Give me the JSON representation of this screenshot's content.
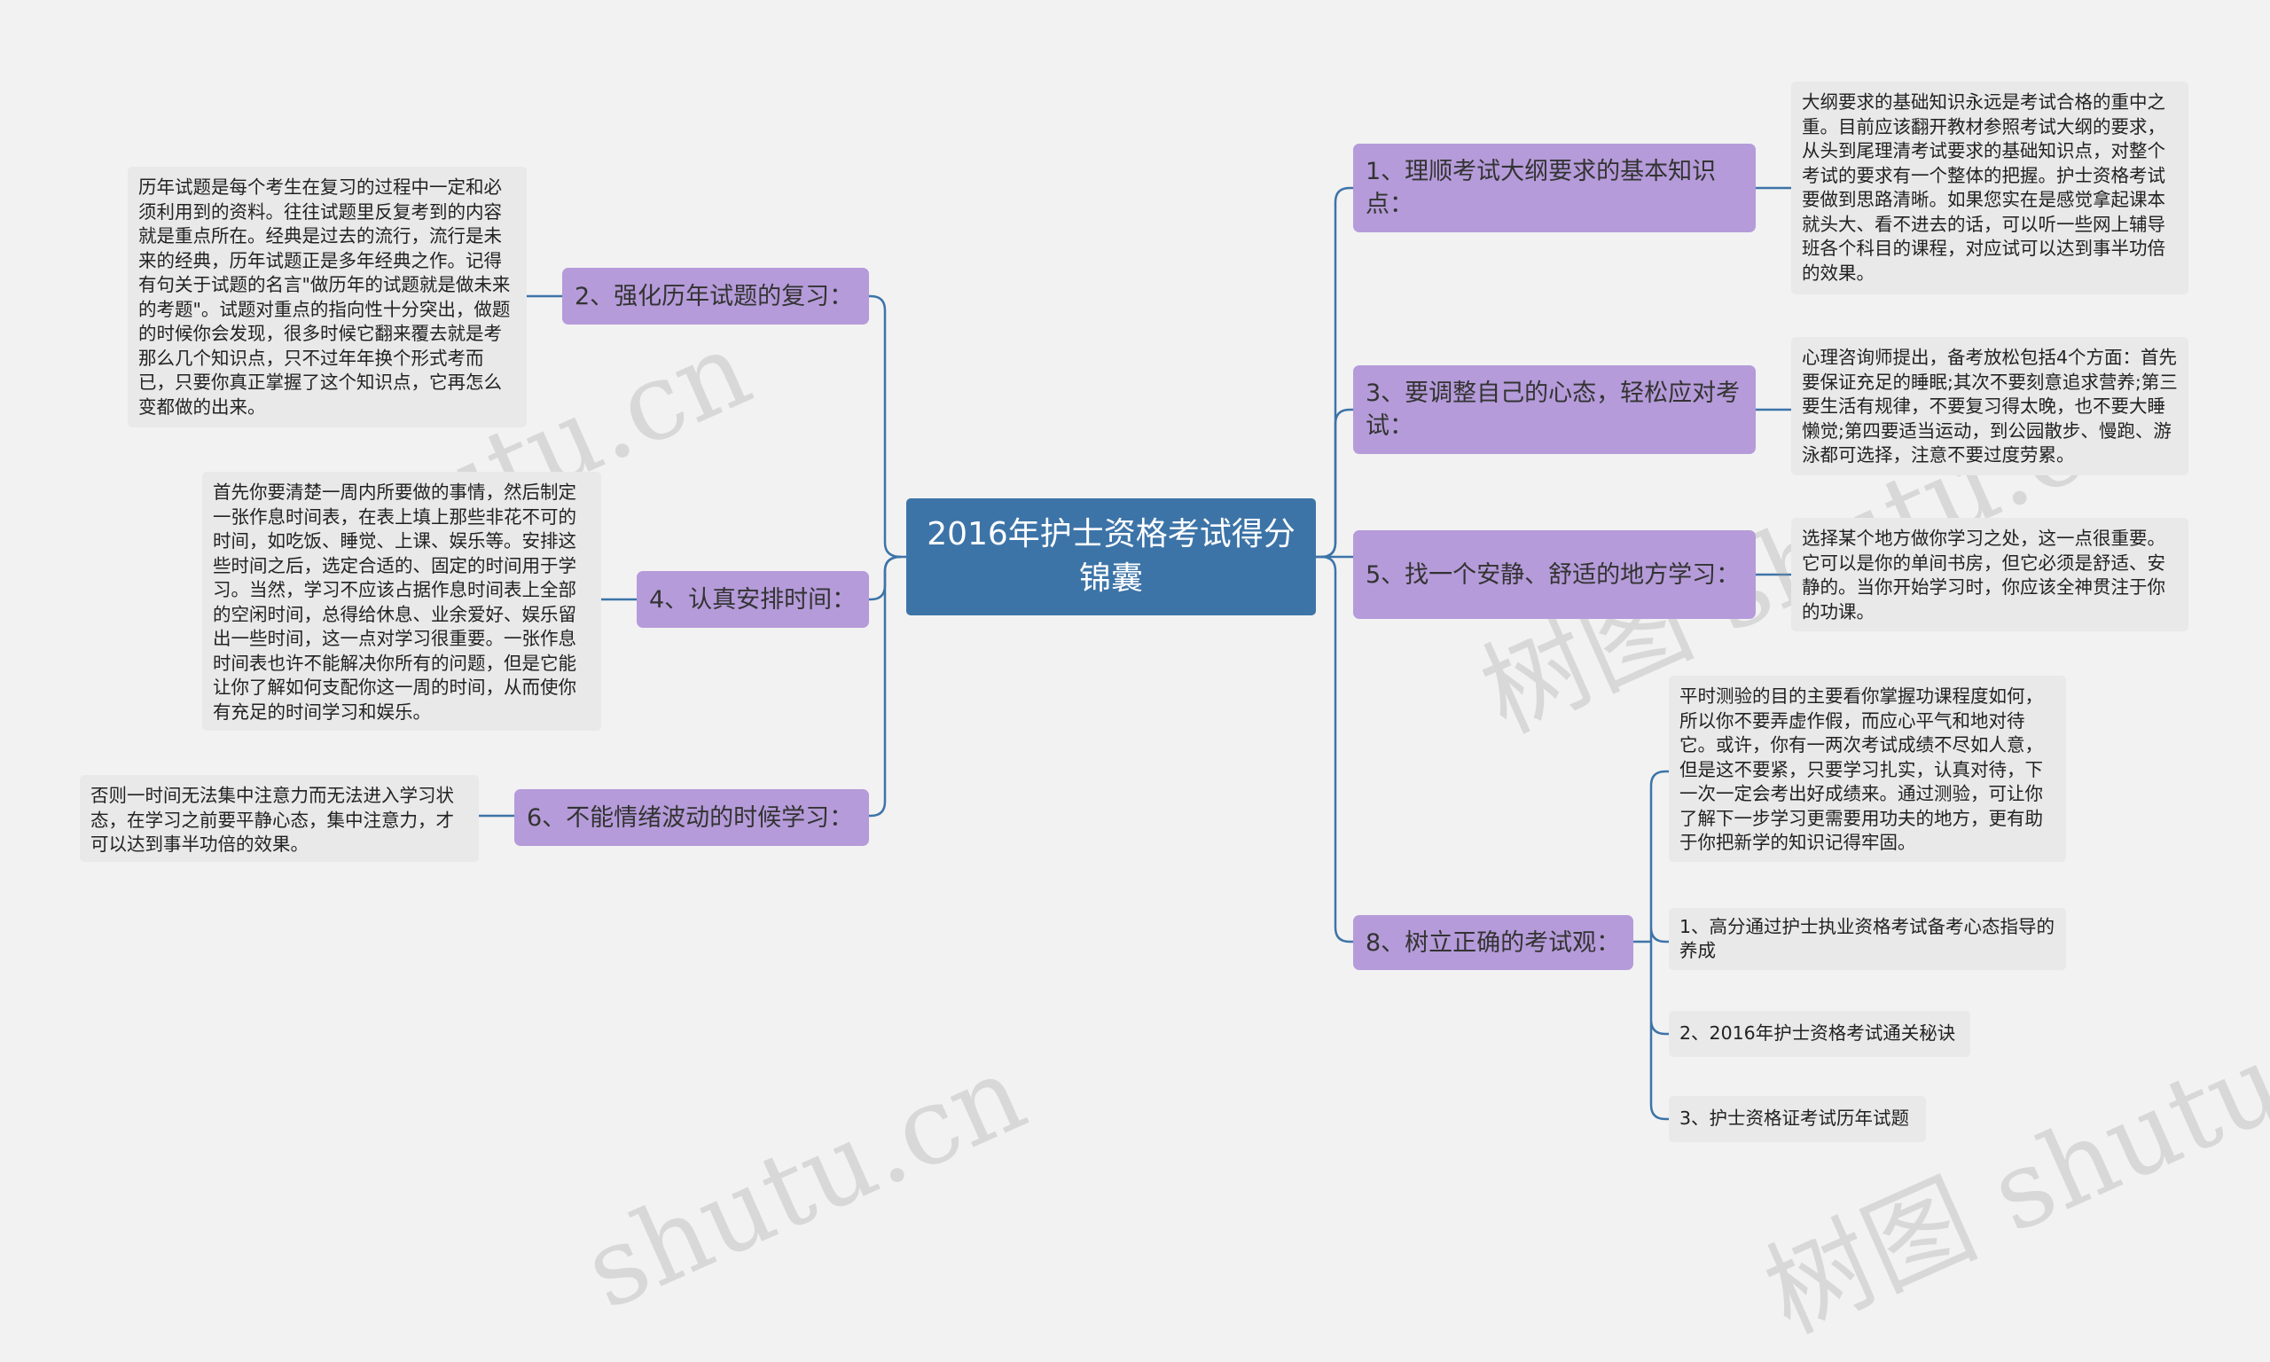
{
  "root": {
    "title": "2016年护士资格考试得分锦囊"
  },
  "branches": {
    "b1": {
      "label": "1、理顺考试大纲要求的基本知识点：",
      "leaf": "大纲要求的基础知识永远是考试合格的重中之重。目前应该翻开教材参照考试大纲的要求，从头到尾理清考试要求的基础知识点，对整个考试的要求有一个整体的把握。护士资格考试要做到思路清晰。如果您实在是感觉拿起课本就头大、看不进去的话，可以听一些网上辅导班各个科目的课程，对应试可以达到事半功倍的效果。"
    },
    "b2": {
      "label": "2、强化历年试题的复习：",
      "leaf": "历年试题是每个考生在复习的过程中一定和必须利用到的资料。往往试题里反复考到的内容就是重点所在。经典是过去的流行，流行是未来的经典，历年试题正是多年经典之作。记得有句关于试题的名言\"做历年的试题就是做未来的考题\"。试题对重点的指向性十分突出，做题的时候你会发现，很多时候它翻来覆去就是考那么几个知识点，只不过年年换个形式考而已，只要你真正掌握了这个知识点，它再怎么变都做的出来。"
    },
    "b3": {
      "label": "3、要调整自己的心态，轻松应对考试：",
      "leaf": "心理咨询师提出，备考放松包括4个方面：首先要保证充足的睡眠;其次不要刻意追求营养;第三要生活有规律，不要复习得太晚，也不要大睡懒觉;第四要适当运动，到公园散步、慢跑、游泳都可选择，注意不要过度劳累。"
    },
    "b4": {
      "label": "4、认真安排时间：",
      "leaf": "首先你要清楚一周内所要做的事情，然后制定一张作息时间表，在表上填上那些非花不可的时间，如吃饭、睡觉、上课、娱乐等。安排这些时间之后，选定合适的、固定的时间用于学习。当然，学习不应该占据作息时间表上全部的空闲时间，总得给休息、业余爱好、娱乐留出一些时间，这一点对学习很重要。一张作息时间表也许不能解决你所有的问题，但是它能让你了解如何支配你这一周的时间，从而使你有充足的时间学习和娱乐。"
    },
    "b5": {
      "label": "5、找一个安静、舒适的地方学习：",
      "leaf": "选择某个地方做你学习之处，这一点很重要。它可以是你的单间书房，但它必须是舒适、安静的。当你开始学习时，你应该全神贯注于你的功课。"
    },
    "b6": {
      "label": "6、不能情绪波动的时候学习：",
      "leaf": "否则一时间无法集中注意力而无法进入学习状态，在学习之前要平静心态，集中注意力，才可以达到事半功倍的效果。"
    },
    "b8": {
      "label": "8、树立正确的考试观：",
      "leaf": "平时测验的目的主要看你掌握功课程度如何，所以你不要弄虚作假，而应心平气和地对待它。或许，你有一两次考试成绩不尽如人意，但是这不要紧，只要学习扎实，认真对待，下一次一定会考出好成绩来。通过测验，可让你了解下一步学习更需要用功夫的地方，更有助于你把新学的知识记得牢固。",
      "links": [
        "1、高分通过护士执业资格考试备考心态指导的养成",
        "2、2016年护士资格考试通关秘诀",
        "3、护士资格证考试历年试题"
      ]
    }
  },
  "watermark": {
    "text1": "树图 shutu.cn",
    "text2": "树图 shutu.cn",
    "text3": "shutu.cn",
    "text4": "shutu.cn"
  },
  "colors": {
    "root": "#3d74a8",
    "branch": "#b59bd9",
    "leaf": "#e9e9e9",
    "line": "#3d74a8",
    "background": "#f2f2f2"
  }
}
